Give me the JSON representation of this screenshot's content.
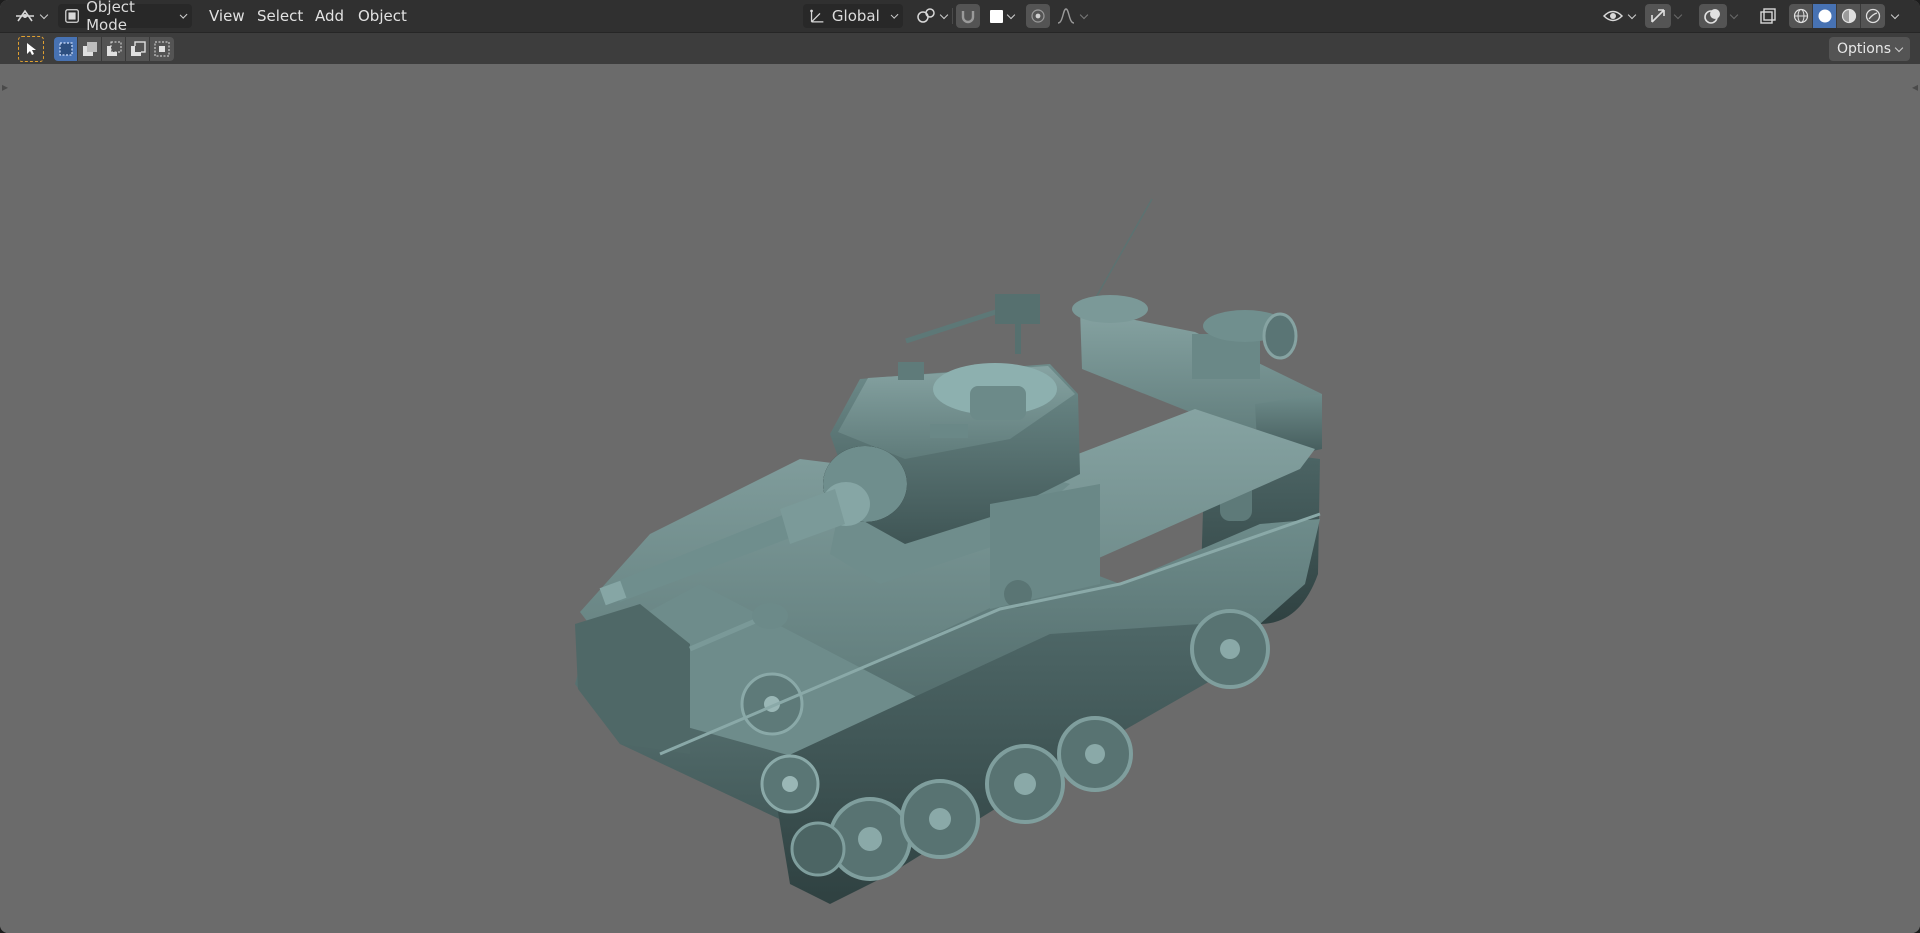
{
  "header": {
    "editor_type_icon": "editor-type-icon",
    "mode": {
      "label": "Object Mode",
      "icon": "object-mode-icon"
    },
    "menus": [
      "View",
      "Select",
      "Add",
      "Object"
    ],
    "transform_orientation": {
      "label": "Global",
      "icon": "transform-orientation-icon"
    },
    "pivot_icon": "pivot-point-icon",
    "snap_icon": "magnet-icon",
    "snap_target_icon": "snap-target-icon",
    "proportional_icon": "proportional-edit-icon",
    "falloff_icon": "falloff-curve-icon",
    "visibility_icon": "eye-icon",
    "gizmo_icon": "gizmo-icon",
    "overlay_icon": "overlay-icon",
    "xray_icon": "xray-icon",
    "shading_modes": [
      "wireframe",
      "solid",
      "material-preview",
      "rendered"
    ],
    "active_shading": "solid"
  },
  "toolbar": {
    "select_tool_icon": "select-box-tool-icon",
    "selection_modes": [
      "set",
      "extend",
      "subtract",
      "invert",
      "intersect"
    ],
    "active_selection_mode": "set",
    "options_label": "Options"
  },
  "viewport": {
    "object": "tank-model",
    "background_color": "#6b6b6b",
    "model_color": "#5f7978"
  },
  "colors": {
    "header_bg": "#303030",
    "toolbar_bg": "#3d3d3d",
    "button_bg": "#545454",
    "accent": "#4772b3",
    "select_tool_accent": "#e0a030"
  }
}
